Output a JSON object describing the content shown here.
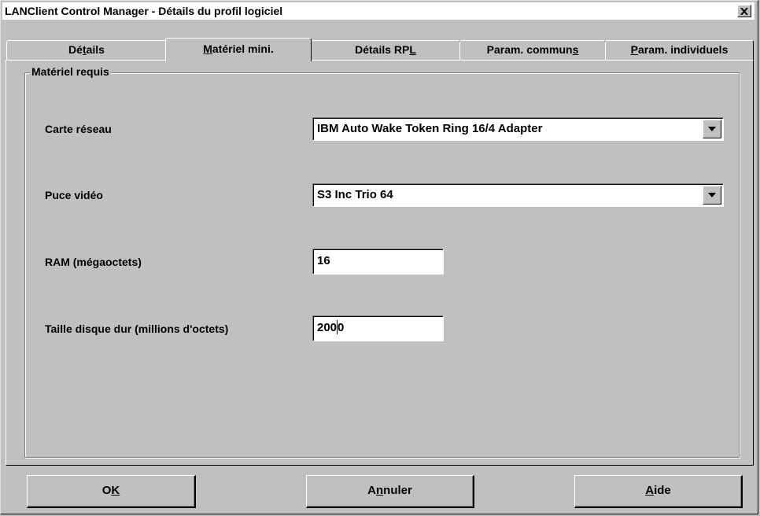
{
  "window": {
    "title": "LANClient Control Manager - Détails du profil logiciel"
  },
  "tabs": [
    {
      "pre": "Dé",
      "key": "t",
      "post": "ails"
    },
    {
      "pre": "",
      "key": "M",
      "post": "atériel mini."
    },
    {
      "pre": "Détails RP",
      "key": "L",
      "post": ""
    },
    {
      "pre": "Param. commun",
      "key": "s",
      "post": ""
    },
    {
      "pre": "",
      "key": "P",
      "post": "aram. individuels"
    }
  ],
  "active_tab": "Matériel mini.",
  "group": {
    "label": "Matériel requis"
  },
  "fields": {
    "network_card": {
      "label": "Carte réseau",
      "value": "IBM Auto Wake Token Ring 16/4 Adapter"
    },
    "video_chip": {
      "label": "Puce vidéo",
      "value": "S3 Inc Trio 64"
    },
    "ram": {
      "label": "RAM (mégaoctets)",
      "value": "16"
    },
    "disk": {
      "label": "Taille disque dur (millions d'octets)",
      "value_before_caret": "200",
      "value_after_caret": "0"
    }
  },
  "buttons": {
    "ok": {
      "pre": "O",
      "key": "K",
      "post": ""
    },
    "cancel": {
      "pre": "A",
      "key": "n",
      "post": "nuler"
    },
    "help": {
      "pre": "",
      "key": "A",
      "post": "ide"
    }
  },
  "icons": {
    "close": "close-icon",
    "dropdown": "triangle-down-icon"
  }
}
